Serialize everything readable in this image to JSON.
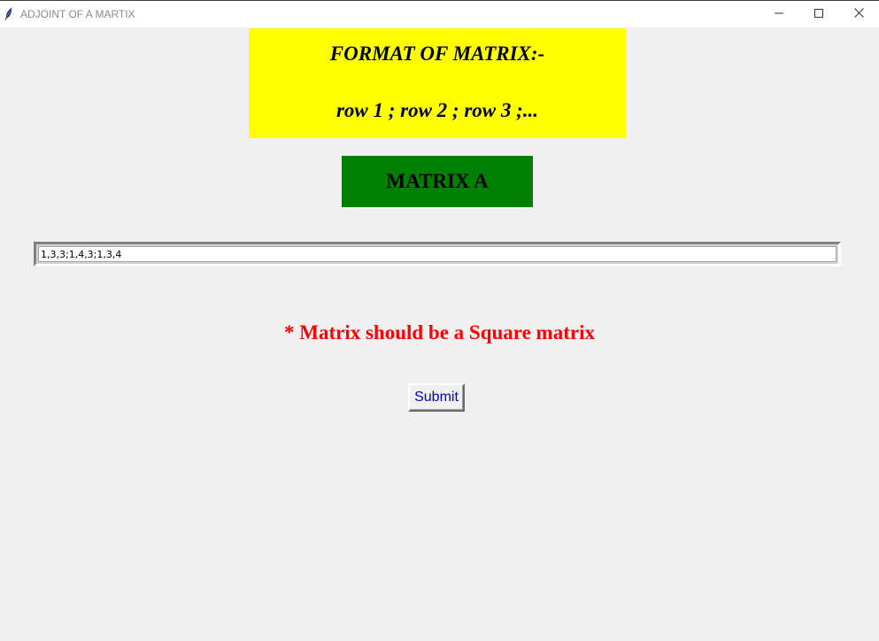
{
  "window": {
    "title": "ADJOINT OF A MARTIX",
    "app_icon": "feather-icon",
    "controls": {
      "minimize_icon": "minimize-icon",
      "maximize_icon": "maximize-icon",
      "close_icon": "close-icon"
    }
  },
  "format_box": {
    "line1": "FORMAT OF MATRIX:-",
    "line2": "row 1 ; row 2 ; row 3 ;...",
    "background": "#ffff00"
  },
  "matrix_label": {
    "text": "MATRIX A",
    "background": "#008000"
  },
  "matrix_input": {
    "value": "1,3,3;1,4,3;1,3,4"
  },
  "warning": {
    "text": "* Matrix should be a Square matrix",
    "color": "#ff0000"
  },
  "submit": {
    "label": "Submit",
    "color": "#0000cd"
  },
  "colors": {
    "window_background": "#f0f0f0",
    "titlebar_background": "#ffffff"
  }
}
